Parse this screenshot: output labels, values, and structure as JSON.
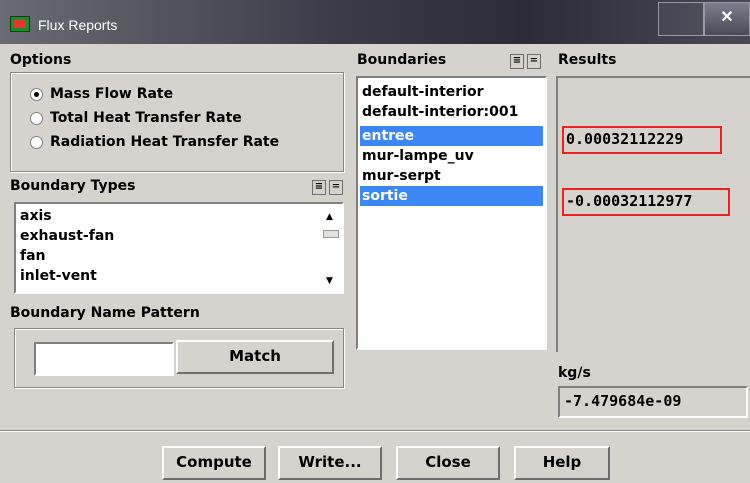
{
  "window": {
    "title": "Flux Reports"
  },
  "options": {
    "label": "Options",
    "items": [
      {
        "label": "Mass Flow Rate",
        "selected": true
      },
      {
        "label": "Total Heat Transfer Rate",
        "selected": false
      },
      {
        "label": "Radiation Heat Transfer Rate",
        "selected": false
      }
    ]
  },
  "boundary_types": {
    "label": "Boundary Types",
    "items": [
      "axis",
      "exhaust-fan",
      "fan",
      "inlet-vent"
    ]
  },
  "pattern": {
    "label": "Boundary Name Pattern",
    "input_value": "",
    "match_label": "Match"
  },
  "boundaries": {
    "label": "Boundaries",
    "items": [
      {
        "label": "default-interior",
        "selected": false
      },
      {
        "label": "default-interior:001",
        "selected": false
      },
      {
        "label": "entree",
        "selected": true
      },
      {
        "label": "mur-lampe_uv",
        "selected": false
      },
      {
        "label": "mur-serpt",
        "selected": false
      },
      {
        "label": "sortie",
        "selected": true
      }
    ]
  },
  "results": {
    "label": "Results",
    "values": [
      "0.00032112229",
      "-0.00032112977"
    ],
    "unit": "kg/s",
    "net": "-7.479684e-09",
    "highlight_color": "#e8231e"
  },
  "buttons": {
    "compute": "Compute",
    "write": "Write...",
    "close": "Close",
    "help": "Help"
  },
  "colors": {
    "selection": "#3d86f5",
    "panel": "#d6d3ce"
  }
}
